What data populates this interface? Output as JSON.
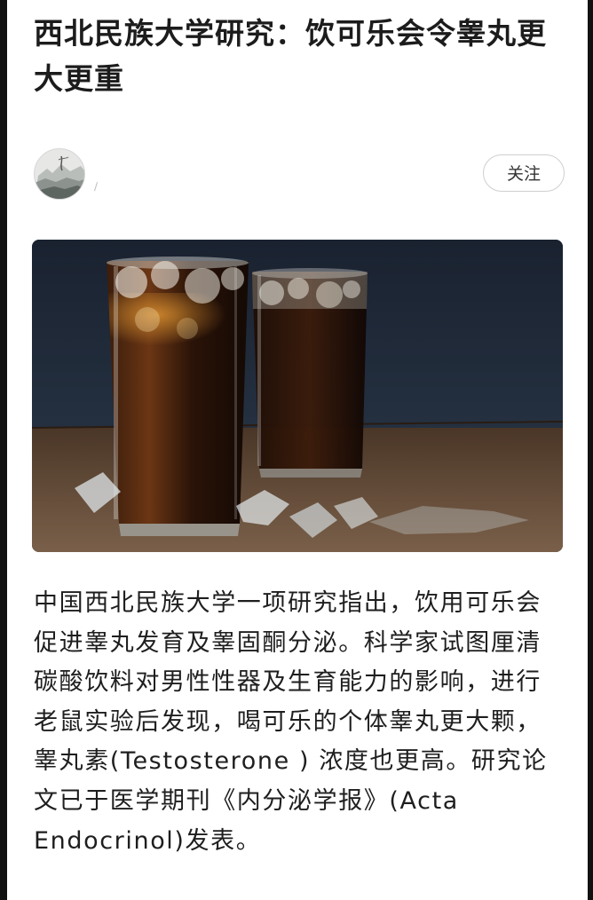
{
  "article": {
    "title": "西北民族大学研究：饮可乐会令睾丸更大更重",
    "body": "中国西北民族大学一项研究指出，饮用可乐会促进睾丸发育及睾固酮分泌。科学家试图厘清碳酸饮料对男性性器及生育能力的影响，进行老鼠实验后发现，喝可乐的个体睾丸更大颗，睾丸素(Testosterone ) 浓度也更高。研究论文已于医学期刊《内分泌学报》(Acta Endocrinol)发表。"
  },
  "author": {
    "avatar_icon": "landscape-painting-avatar",
    "follow_label": "关注"
  },
  "image": {
    "subject": "two-glasses-of-cola-with-ice"
  },
  "colors": {
    "background": "#ffffff",
    "text": "#1e1e1e",
    "frame": "#111111",
    "button_border": "#cfcfcf"
  }
}
